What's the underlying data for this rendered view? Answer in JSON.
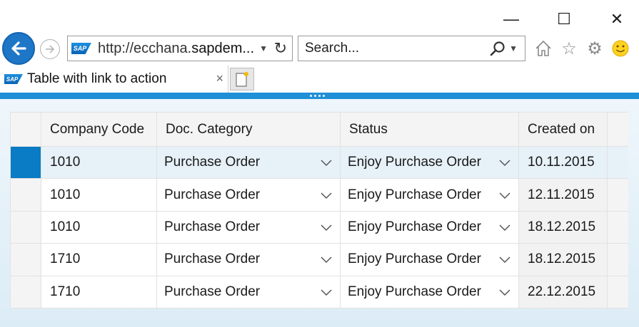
{
  "window": {
    "minimize_glyph": "—",
    "maximize_glyph": "☐",
    "close_glyph": "✕"
  },
  "navbar": {
    "url_prefix": "http://ecchana.",
    "url_domain": "sapdem...",
    "search_placeholder": "Search...",
    "icons": [
      "back-arrow-icon",
      "forward-arrow-icon",
      "refresh-icon",
      "search-icon",
      "home-icon",
      "favorites-star-icon",
      "settings-gear-icon",
      "smiley-feedback-icon"
    ]
  },
  "tab": {
    "title": "Table with link to action",
    "close_glyph": "×"
  },
  "logo_text": "SAP",
  "table": {
    "columns": [
      "Company Code",
      "Doc. Category",
      "Status",
      "Created on"
    ],
    "rows": [
      {
        "company_code": "1010",
        "doc_category": "Purchase Order",
        "status": "Enjoy Purchase Order",
        "created_on": "10.11.2015",
        "selected": true
      },
      {
        "company_code": "1010",
        "doc_category": "Purchase Order",
        "status": "Enjoy Purchase Order",
        "created_on": "12.11.2015",
        "selected": false
      },
      {
        "company_code": "1010",
        "doc_category": "Purchase Order",
        "status": "Enjoy Purchase Order",
        "created_on": "18.12.2015",
        "selected": false
      },
      {
        "company_code": "1710",
        "doc_category": "Purchase Order",
        "status": "Enjoy Purchase Order",
        "created_on": "18.12.2015",
        "selected": false
      },
      {
        "company_code": "1710",
        "doc_category": "Purchase Order",
        "status": "Enjoy Purchase Order",
        "created_on": "22.12.2015",
        "selected": false
      }
    ]
  },
  "colors": {
    "accent": "#1f8fd7",
    "selected_row": "#e6f1f8",
    "selected_marker": "#0a7bc5"
  }
}
